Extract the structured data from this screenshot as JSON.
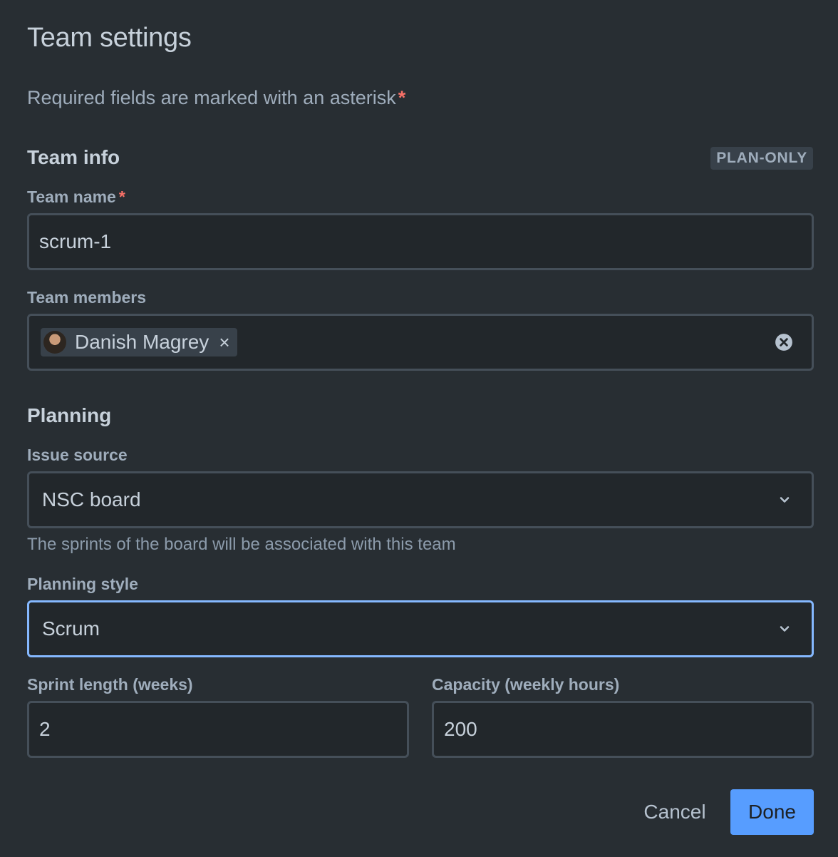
{
  "dialog": {
    "title": "Team settings",
    "required_note": "Required fields are marked with an asterisk",
    "required_marker": "*"
  },
  "team_info": {
    "heading": "Team info",
    "badge": "PLAN-ONLY",
    "team_name": {
      "label": "Team name",
      "value": "scrum-1"
    },
    "team_members": {
      "label": "Team members",
      "members": [
        {
          "name": "Danish Magrey",
          "remove_glyph": "×"
        }
      ]
    }
  },
  "planning": {
    "heading": "Planning",
    "issue_source": {
      "label": "Issue source",
      "value": "NSC board",
      "helper": "The sprints of the board will be associated with this team"
    },
    "planning_style": {
      "label": "Planning style",
      "value": "Scrum"
    },
    "sprint_length": {
      "label": "Sprint length (weeks)",
      "value": "2"
    },
    "capacity": {
      "label": "Capacity (weekly hours)",
      "value": "200"
    }
  },
  "footer": {
    "cancel_label": "Cancel",
    "done_label": "Done"
  },
  "colors": {
    "background": "#282e33",
    "field_bg": "#22272b",
    "field_border": "#454f59",
    "focus_border": "#85b8ff",
    "primary_button": "#579dff",
    "required": "#f87168"
  }
}
